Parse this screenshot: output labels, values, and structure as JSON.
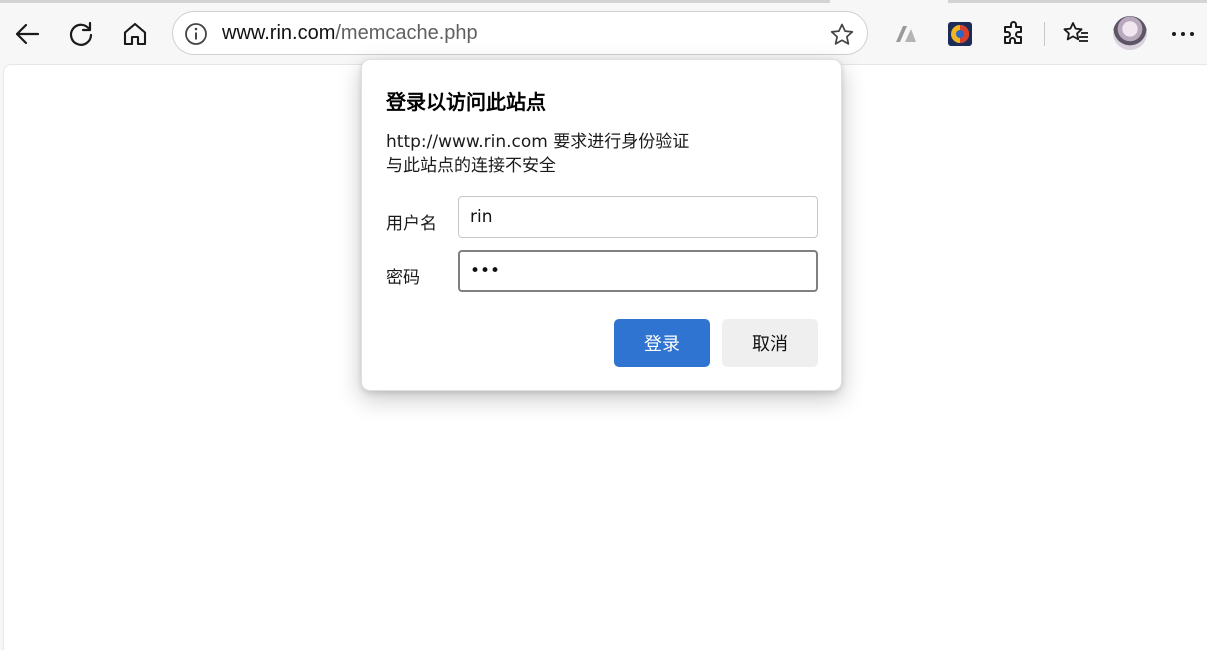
{
  "address_bar": {
    "host": "www.rin.com",
    "path": "/memcache.php"
  },
  "icons": {
    "back": "back-arrow-icon",
    "refresh": "refresh-icon",
    "home": "home-icon",
    "info": "info-icon",
    "favorite": "star-icon",
    "extension_a": "extension-a-icon",
    "extension_color": "extension-color-icon",
    "extensions": "puzzle-icon",
    "favorites": "favorites-icon",
    "more": "more-icon"
  },
  "dialog": {
    "title": "登录以访问此站点",
    "line1": "http://www.rin.com 要求进行身份验证",
    "line2": "与此站点的连接不安全",
    "username_label": "用户名",
    "username_value": "rin",
    "password_label": "密码",
    "password_value": "•••",
    "login_button": "登录",
    "cancel_button": "取消"
  },
  "colors": {
    "primary": "#2f74d0",
    "secondary": "#efefef"
  }
}
